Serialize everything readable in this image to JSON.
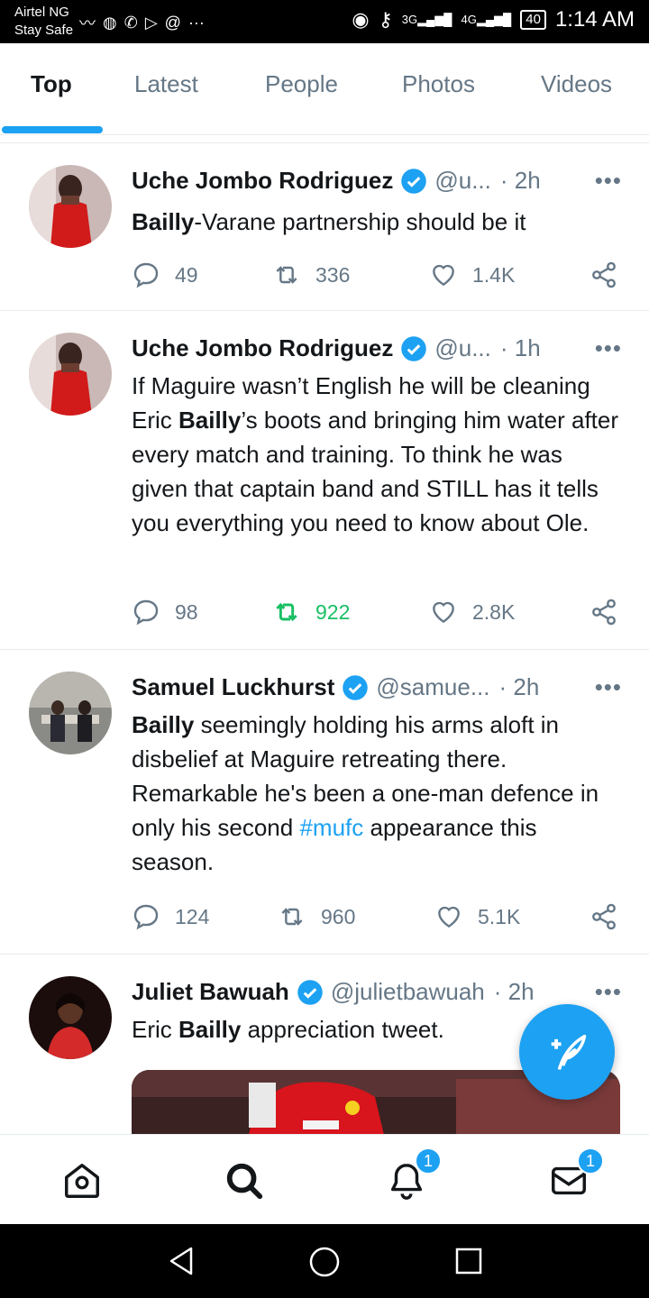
{
  "status_bar": {
    "carrier_line1": "Airtel NG",
    "carrier_line2": "Stay Safe",
    "network_1": "3G",
    "network_2": "4G",
    "battery": "40",
    "time": "1:14 AM"
  },
  "tabs": [
    {
      "label": "Top",
      "active": true
    },
    {
      "label": "Latest",
      "active": false
    },
    {
      "label": "People",
      "active": false
    },
    {
      "label": "Photos",
      "active": false
    },
    {
      "label": "Videos",
      "active": false
    }
  ],
  "tweets": [
    {
      "name": "Uche Jombo Rodriguez",
      "handle": "@u...",
      "time": "· 2h",
      "more": "•••",
      "text_bold": "Bailly",
      "text_rest": "-Varane partnership should be it",
      "replies": "49",
      "retweets": "336",
      "likes": "1.4K"
    },
    {
      "name": "Uche Jombo Rodriguez",
      "handle": "@u...",
      "time": "· 1h",
      "more": "•••",
      "text_pre": "If Maguire wasn’t English he will be cleaning Eric ",
      "text_bold": "Bailly",
      "text_post": "’s boots and bringing him water after every match and training. To think he was given that captain band and STILL has it tells you everything you need to know about Ole.",
      "replies": "98",
      "retweets": "922",
      "likes": "2.8K"
    },
    {
      "name": "Samuel Luckhurst",
      "handle": "@samue...",
      "time": "· 2h",
      "more": "•••",
      "text_bold": "Bailly",
      "text_mid": " seemingly holding his arms aloft in disbelief at Maguire retreating there. Remarkable he's been a one-man defence in only his second ",
      "hashtag": "#mufc",
      "text_post": " appearance this season.",
      "replies": "124",
      "retweets": "960",
      "likes": "5.1K"
    },
    {
      "name": "Juliet Bawuah",
      "handle": "@julietbawuah",
      "time": "· 2h",
      "more": "•••",
      "text_pre": "Eric ",
      "text_bold": "Bailly",
      "text_post": " appreciation tweet."
    }
  ],
  "bottom_nav": {
    "notifications_badge": "1",
    "messages_badge": "1"
  },
  "colors": {
    "accent": "#1da1f2",
    "retweet_active": "#17bf63",
    "muted": "#657786"
  }
}
